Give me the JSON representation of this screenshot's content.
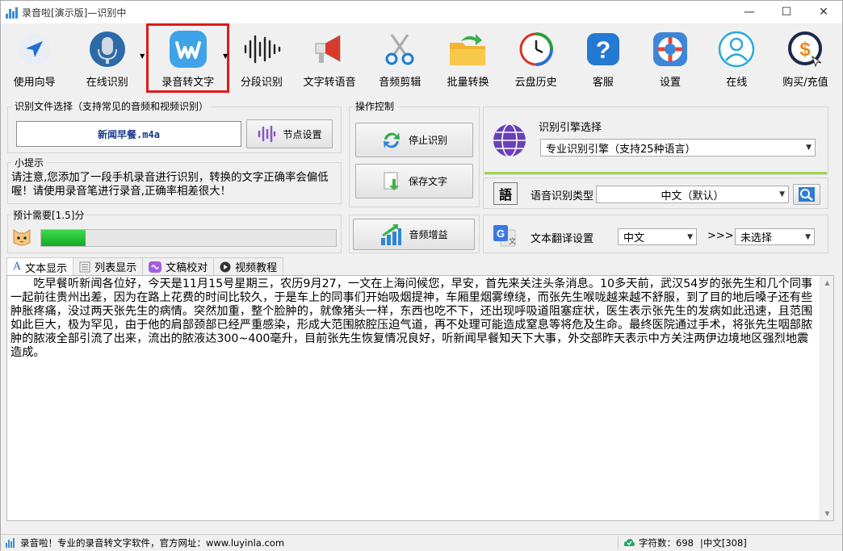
{
  "window": {
    "title": "录音啦[演示版]—识别中",
    "controls": {
      "minimize": "—",
      "maximize": "☐",
      "close": "✕"
    }
  },
  "toolbar": {
    "items": [
      {
        "id": "guide",
        "label": "使用向导",
        "icon": "navigation-arrow-icon"
      },
      {
        "id": "online",
        "label": "在线识别",
        "icon": "microphone-icon",
        "dropdown": true
      },
      {
        "id": "convert",
        "label": "录音转文字",
        "icon": "w-logo-icon",
        "dropdown": true,
        "selected": true
      },
      {
        "id": "segment",
        "label": "分段识别",
        "icon": "waveform-icon"
      },
      {
        "id": "tts",
        "label": "文字转语音",
        "icon": "megaphone-icon"
      },
      {
        "id": "cut",
        "label": "音频剪辑",
        "icon": "scissors-icon"
      },
      {
        "id": "batch",
        "label": "批量转换",
        "icon": "folder-arrow-icon"
      },
      {
        "id": "cloud",
        "label": "云盘历史",
        "icon": "clock-history-icon"
      },
      {
        "id": "service",
        "label": "客服",
        "icon": "help-icon"
      },
      {
        "id": "settings",
        "label": "设置",
        "icon": "lifebuoy-icon"
      },
      {
        "id": "status",
        "label": "在线",
        "icon": "user-icon"
      },
      {
        "id": "buy",
        "label": "购买/充值",
        "icon": "dollar-coin-icon"
      }
    ]
  },
  "file_select": {
    "title": "识别文件选择（支持常见的音频和视频识别）",
    "filename": "新闻早餐.m4a",
    "node_button": "节点设置"
  },
  "tips": {
    "title": "小提示",
    "text": "请注意,您添加了一段手机录音进行识别，转换的文字正确率会偏低喔！请使用录音笔进行录音,正确率相差很大！"
  },
  "estimate": {
    "title": "预计需要[1.5]分",
    "progress": 0.15
  },
  "operation": {
    "title": "操作控制",
    "stop": "停止识别",
    "save": "保存文字",
    "enhance": "音频增益"
  },
  "engine": {
    "title": "识别引擎选择",
    "value": "专业识别引擎（支持25种语言）"
  },
  "speech_type": {
    "label": "语音识别类型",
    "value": "中文（默认）",
    "icon_char": "語"
  },
  "translate": {
    "label": "文本翻译设置",
    "from": "中文",
    "arrow": ">>>",
    "to": "未选择"
  },
  "tabs": [
    {
      "label": "文本显示",
      "icon": "text-a-icon",
      "active": true
    },
    {
      "label": "列表显示",
      "icon": "list-icon"
    },
    {
      "label": "文稿校对",
      "icon": "proofread-icon"
    },
    {
      "label": "视频教程",
      "icon": "video-icon"
    }
  ],
  "transcript": "吃早餐听新闻各位好，今天是11月15号星期三，农历9月27，一文在上海问候您，早安，首先来关注头条消息。10多天前，武汉54岁的张先生和几个同事一起前往贵州出差，因为在路上花费的时间比较久，于是车上的同事们开始吸烟提神，车厢里烟雾缭绕，而张先生喉咙越来越不舒服，到了目的地后嗓子还有些肿胀疼痛，没过两天张先生的病情。突然加重，整个脸肿的，就像猪头一样，东西也吃不下，还出现呼吸道阻塞症状，医生表示张先生的发病如此迅速，且范围如此巨大，极为罕见，由于他的肩部颈部已经严重感染，形成大范围脓腔压迫气道，再不处理可能造成窒息等将危及生命。最终医院通过手术，将张先生咽部脓肿的脓液全部引流了出来，流出的脓液达300~400毫升，目前张先生恢复情况良好，听新闻早餐知天下大事，外交部昨天表示中方关注两伊边境地区强烈地震造成。",
  "statusbar": {
    "left": "录音啦！专业的录音转文字软件，官方网址：www.luyinla.com",
    "chars": "字符数：698",
    "lang": "|中文[308]"
  },
  "colors": {
    "accent_blue": "#2a8bd8",
    "progress_green": "#1dbf2f",
    "selected_border": "#e01a1a",
    "engine_underline": "#9bd84b"
  }
}
